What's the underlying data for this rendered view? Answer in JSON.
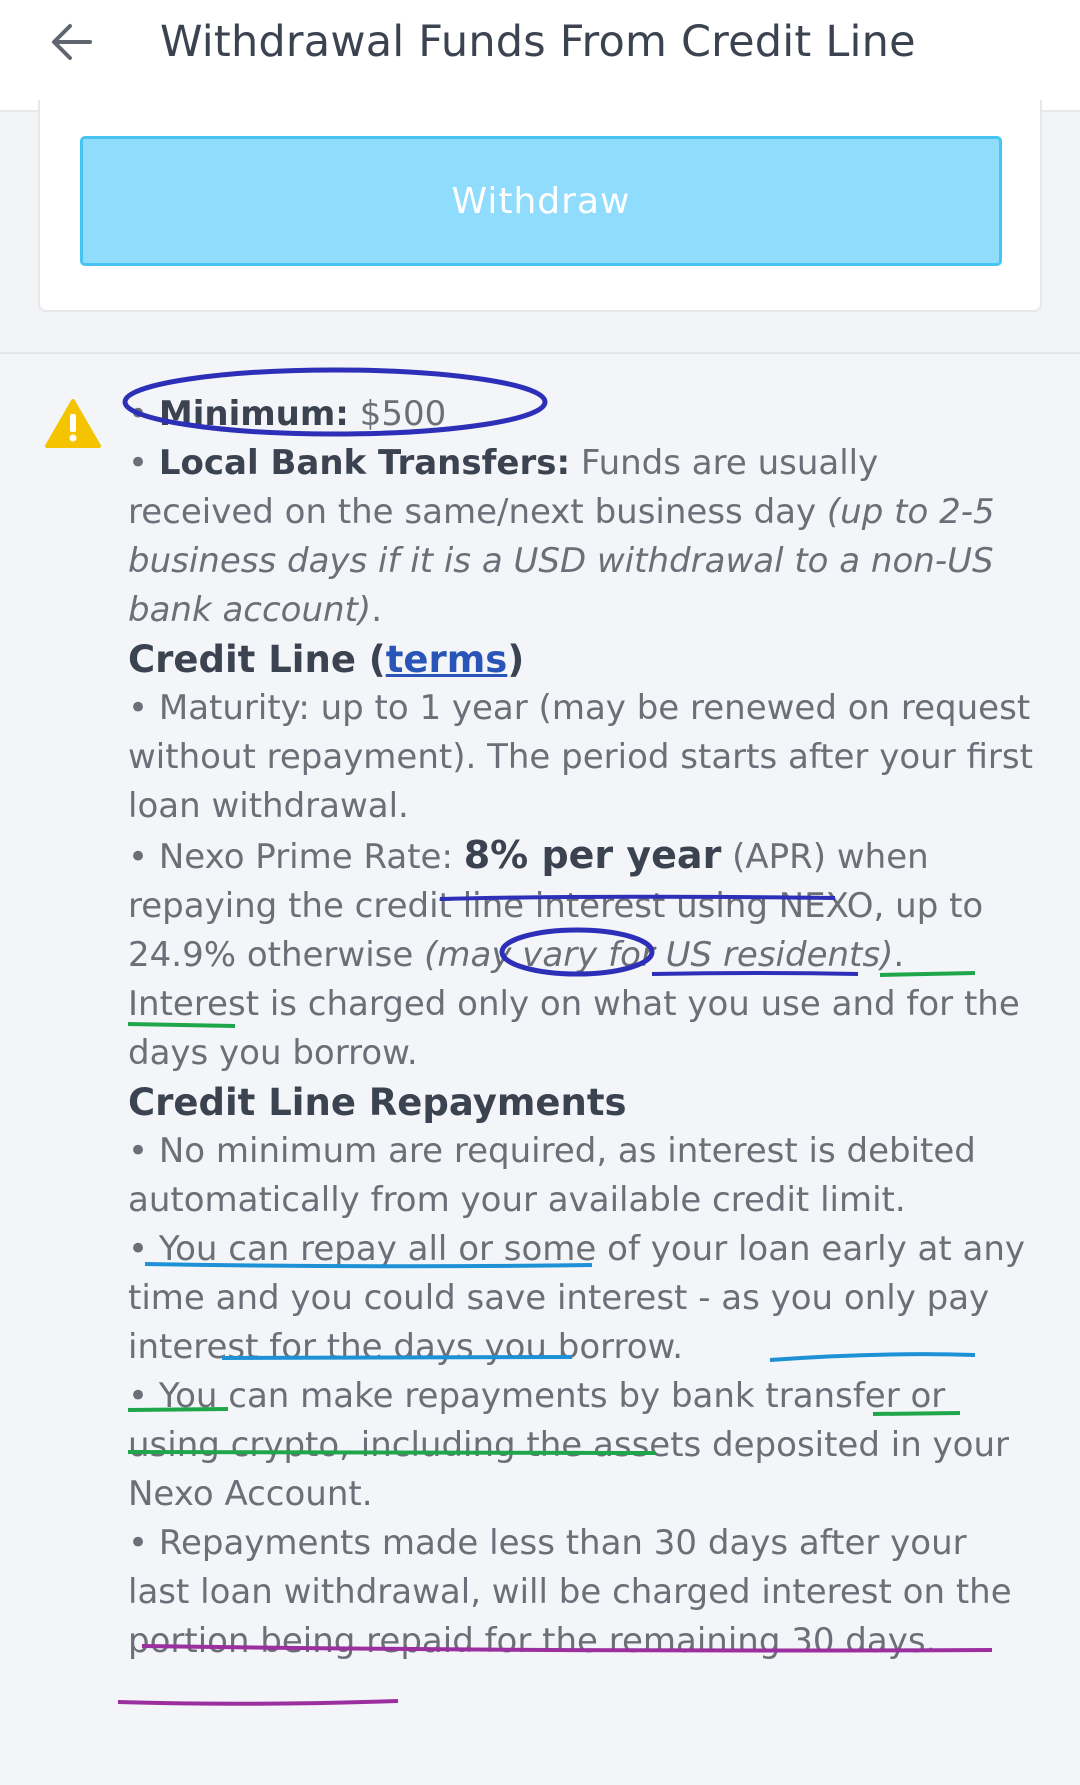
{
  "header": {
    "title": "Withdrawal Funds From Credit Line",
    "back_icon": "arrow-left-icon"
  },
  "card": {
    "withdraw_label": "Withdraw"
  },
  "notice": {
    "icon": "warning-icon",
    "minimum_label": "Minimum:",
    "minimum_value": "$500",
    "bank_label": "Local Bank Transfers:",
    "bank_text": "Funds are usually received on the same/next business day",
    "bank_italic": "(up to 2-5 business days if it is a USD withdrawal to a non-US bank account)",
    "bank_end": "."
  },
  "credit_line": {
    "title_prefix": "Credit Line (",
    "terms_link": "terms",
    "title_suffix": ")",
    "maturity": "• Maturity: up to 1 year (may be renewed on request without repayment). The period starts after your first loan withdrawal.",
    "rate_prefix": "• Nexo Prime Rate: ",
    "rate_bold": "8% per year",
    "rate_mid": " (APR) when repaying the credit line interest using NEXO, up to 24.9% otherwise ",
    "rate_italic": "(may vary for US residents)",
    "rate_end": ". Interest is charged only on what you use and for the days you borrow."
  },
  "repayments": {
    "title": "Credit Line Repayments",
    "item1": "• No minimum are required, as interest is debited automatically from your available credit limit.",
    "item2": "• You can repay all or some of your loan early at any time and you could save interest - as you only pay interest for the days you borrow.",
    "item3": "• You can make repayments by bank transfer or using crypto, including the assets deposited in your Nexo Account.",
    "item4": "• Repayments made less than 30 days after your last loan withdrawal, will be charged interest on the portion being repaid for the remaining 30 days."
  },
  "colors": {
    "accent_button": "#8fdcfd",
    "button_border": "#47c4f1",
    "link": "#2a55b8",
    "warning": "#f5c400",
    "annotation_navy": "#2e2fb8",
    "annotation_blue": "#1e90d6",
    "annotation_green": "#1fa64a",
    "annotation_purple": "#9b2fa0"
  }
}
